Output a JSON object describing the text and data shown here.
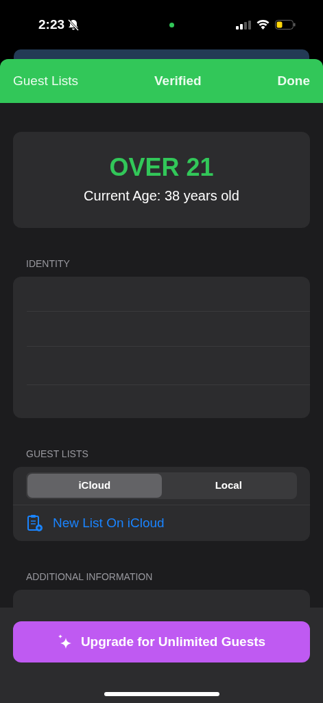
{
  "status_bar": {
    "time": "2:23"
  },
  "nav_bar": {
    "back": "Guest Lists",
    "title": "Verified",
    "done": "Done"
  },
  "age_card": {
    "status": "OVER 21",
    "detail": "Current Age: 38 years old"
  },
  "sections": [
    {
      "header": "IDENTITY",
      "kind": "blank"
    },
    {
      "header": "GUEST LISTS",
      "kind": "lists",
      "segments": [
        {
          "label": "iCloud",
          "selected": true
        },
        {
          "label": "Local",
          "selected": false
        }
      ],
      "action": "New List On iCloud"
    },
    {
      "header": "ADDITIONAL INFORMATION",
      "kind": "blank"
    }
  ],
  "upgrade_button": "Upgrade for Unlimited Guests"
}
